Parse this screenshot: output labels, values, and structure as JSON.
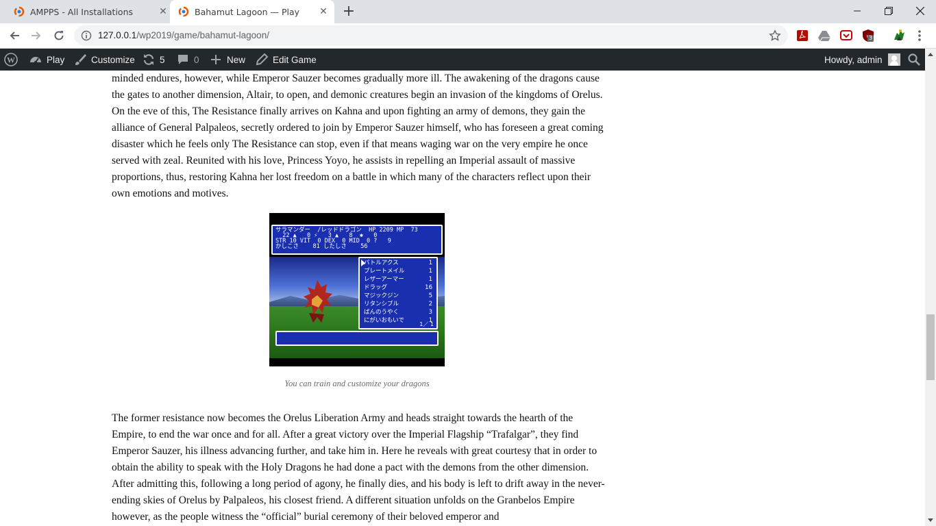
{
  "browser": {
    "tabs": [
      {
        "title": "AMPPS - All Installations",
        "active": false
      },
      {
        "title": "Bahamut Lagoon — Play",
        "active": true
      }
    ],
    "url": {
      "host": "127.0.0.1",
      "path": "/wp2019/game/bahamut-lagoon/"
    },
    "extension_badge": "3"
  },
  "adminbar": {
    "play": "Play",
    "customize": "Customize",
    "updates": "5",
    "comments": "0",
    "new": "New",
    "edit": "Edit Game",
    "howdy": "Howdy, admin"
  },
  "article": {
    "paragraph1": "minded endures, however, while Emperor Sauzer becomes gradually more ill. The awakening of the dragons cause the gates to another dimension, Altair, to open, and demonic creatures begin an invasion of the kingdoms of Orelus. On the eve of this, The Resistance finally arrives on Kahna and upon fighting an army of demons, they gain the alliance of General Palpaleos, secretly ordered to join by Emperor Sauzer himself, who has foreseen a great coming disaster which he feels only The Resistance can stop, even if that means waging war on the very empire he once served with zeal. Reunited with his love, Princess Yoyo, he assists in repelling an Imperial assault of massive proportions, thus, restoring Kahna her lost freedom on a battle in which many of the characters reflect upon their own emotions and motives.",
    "caption": "You can train and customize your dragons",
    "paragraph2": "The former resistance now becomes the Orelus Liberation Army and heads straight towards the hearth of the Empire, to end the war once and for all. After a great victory over the Imperial Flagship “Trafalgar”, they find Emperor Sauzer, his illness advancing further, and take him in. Here he reveals with great courtesy that in order to obtain the ability to speak with the Holy Dragons he had done a pact with the demons from the other dimension. After admitting this, following a long period of agony, he finally dies, and his body is left to drift away in the never-ending skies of Orelus by Palpaleos, his closest friend. A different situation unfolds on the Granbelos Empire however, as the people witness the “official” burial ceremony of their beloved emperor and"
  },
  "game_screen": {
    "stat_rows": [
      "サラマンダー  /レッドドラゴン  HP 2209 MP  73",
      "  22 ▲   0 ⚡   3 ▲   8  ✱   0",
      "STR 10 VIT  0 DEX  0 MID  0 ?   9",
      "かしこさ    81 したしさ    56"
    ],
    "items": [
      {
        "name": "バトルアクス",
        "qty": "1"
      },
      {
        "name": "プレートメイル",
        "qty": "1"
      },
      {
        "name": "レザーアーマー",
        "qty": "1"
      },
      {
        "name": "ドラッグ",
        "qty": "16"
      },
      {
        "name": "マジックジン",
        "qty": "5"
      },
      {
        "name": "リタンシブル",
        "qty": "2"
      },
      {
        "name": "ばんのうやく",
        "qty": "3"
      },
      {
        "name": "にがいおもいで",
        "qty": "1"
      }
    ],
    "pager": "1／ 1"
  },
  "colors": {
    "adminbar_bg": "#23282d",
    "game_panel": "#1a2fb0",
    "tabstrip": "#dee1e6"
  }
}
